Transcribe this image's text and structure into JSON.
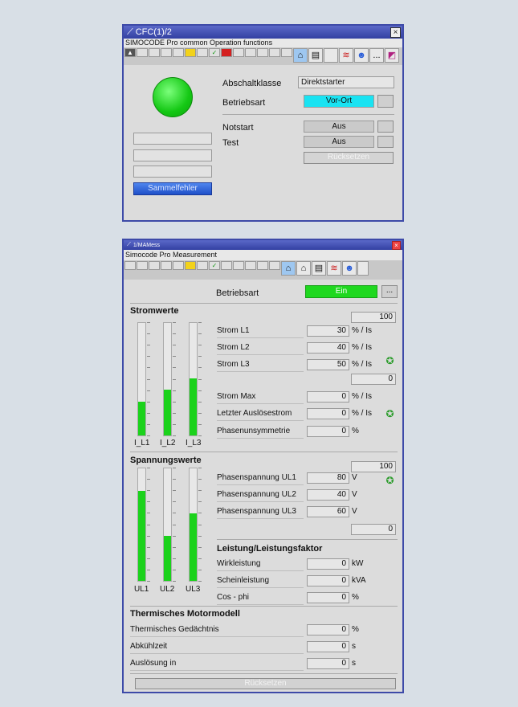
{
  "win1": {
    "title": "CFC(1)/2",
    "close": "×",
    "subtitle": "SIMOCODE Pro common Operation functions",
    "toolbar_more": "...",
    "abschaltklasse_label": "Abschaltklasse",
    "abschaltklasse_value": "Direktstarter",
    "betriebsart_label": "Betriebsart",
    "betriebsart_value": "Vor-Ort",
    "notstart_label": "Notstart",
    "notstart_value": "Aus",
    "test_label": "Test",
    "test_value": "Aus",
    "reset_button": "Rücksetzen",
    "sammelfehler": "Sammelfehler",
    "status_color": "#1fd81f",
    "accent_cyan": "#19e3f2",
    "accent_blue": "#2c5ed8"
  },
  "win2": {
    "title": "1/MAMess",
    "close": "×",
    "subtitle": "Simocode Pro Measurement",
    "toolbar_more": "...",
    "betriebsart_label": "Betriebsart",
    "betriebsart_value": "Ein",
    "betriebsart_btn": "...",
    "stromwerte": {
      "title": "Stromwerte",
      "scale_max": "100",
      "scale_min": "0",
      "rows": [
        {
          "label": "Strom L1",
          "value": "30",
          "unit": "% / Is"
        },
        {
          "label": "Strom L2",
          "value": "40",
          "unit": "% / Is"
        },
        {
          "label": "Strom L3",
          "value": "50",
          "unit": "% / Is"
        },
        {
          "label": "Strom Max",
          "value": "0",
          "unit": "% / Is"
        },
        {
          "label": "Letzter Auslösestrom",
          "value": "0",
          "unit": "% / Is"
        },
        {
          "label": "Phasenunsymmetrie",
          "value": "0",
          "unit": "%"
        }
      ],
      "bars": [
        {
          "label": "I_L1",
          "level": 0.3
        },
        {
          "label": "I_L2",
          "level": 0.41
        },
        {
          "label": "I_L3",
          "level": 0.51
        }
      ]
    },
    "spannungswerte": {
      "title": "Spannungswerte",
      "scale_max": "100",
      "scale_min": "0",
      "rows": [
        {
          "label": "Phasenspannung UL1",
          "value": "80",
          "unit": "V"
        },
        {
          "label": "Phasenspannung UL2",
          "value": "40",
          "unit": "V"
        },
        {
          "label": "Phasenspannung UL3",
          "value": "60",
          "unit": "V"
        }
      ],
      "bars": [
        {
          "label": "UL1",
          "level": 0.8
        },
        {
          "label": "UL2",
          "level": 0.4
        },
        {
          "label": "UL3",
          "level": 0.6
        }
      ]
    },
    "leistung": {
      "title": "Leistung/Leistungsfaktor",
      "rows": [
        {
          "label": "Wirkleistung",
          "value": "0",
          "unit": "kW"
        },
        {
          "label": "Scheinleistung",
          "value": "0",
          "unit": "kVA"
        },
        {
          "label": "Cos - phi",
          "value": "0",
          "unit": "%"
        }
      ]
    },
    "motormodell": {
      "title": "Thermisches Motormodell",
      "rows": [
        {
          "label": "Thermisches Gedächtnis",
          "value": "0",
          "unit": "%"
        },
        {
          "label": "Abkühlzeit",
          "value": "0",
          "unit": "s"
        },
        {
          "label": "Auslösung in",
          "value": "0",
          "unit": "s"
        }
      ]
    },
    "bottom_button": "Rücksetzen",
    "bar_color": "#1bd21b",
    "refresh_color": "#2c9c2c"
  }
}
